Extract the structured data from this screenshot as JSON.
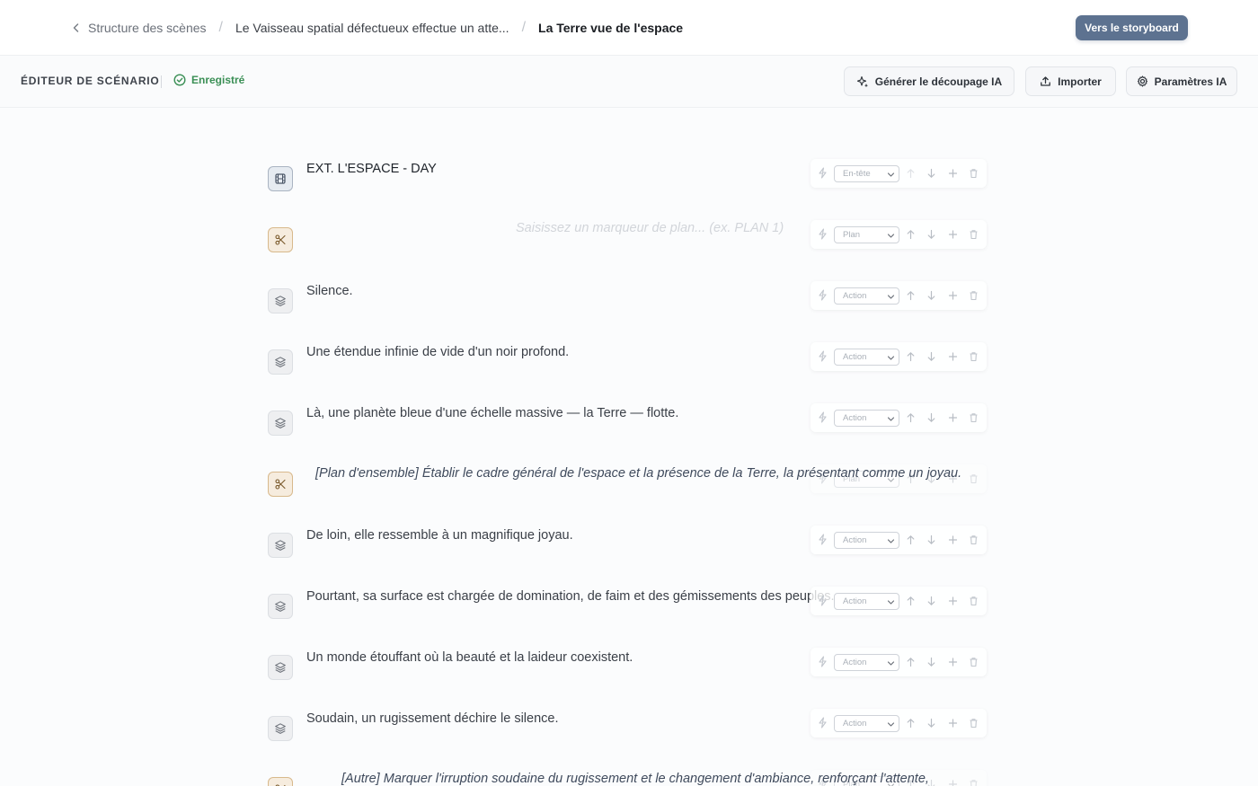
{
  "breadcrumb": {
    "back_label": "Structure des scènes",
    "middle_label": "Le Vaisseau spatial défectueux effectue un atte...",
    "current_label": "La Terre vue de l'espace"
  },
  "header": {
    "primary_button_label": "Vers le storyboard"
  },
  "toolbar": {
    "title": "ÉDITEUR DE SCÉNARIO",
    "save_status": "Enregistré",
    "generate_label": "Générer le découpage IA",
    "import_label": "Importer",
    "settings_label": "Paramètres IA"
  },
  "colors": {
    "accent": "#5d7290",
    "saved": "#3a8f55",
    "shot_icon_bg": "#f6ecde",
    "heading_icon_bg": "#e6ebf1"
  },
  "rows": [
    {
      "kind": "heading",
      "icon": "film-icon",
      "text": "EXT. L'ESPACE - DAY",
      "type_label": "En-tête"
    },
    {
      "kind": "shot",
      "icon": "scissors-icon",
      "text": "",
      "placeholder": "Saisissez un marqueur de plan... (ex. PLAN 1)",
      "type_label": "Plan"
    },
    {
      "kind": "action",
      "icon": "layers-icon",
      "text": "Silence.",
      "type_label": "Action"
    },
    {
      "kind": "action",
      "icon": "layers-icon",
      "text": "Une étendue infinie de vide d'un noir profond.",
      "type_label": "Action"
    },
    {
      "kind": "action",
      "icon": "layers-icon",
      "text": "Là, une planète bleue d'une échelle massive — la Terre — flotte.",
      "type_label": "Action"
    },
    {
      "kind": "shot",
      "icon": "scissors-icon",
      "text": "[Plan d'ensemble] Établir le cadre général de l'espace et la présence de la Terre, la présentant comme un joyau.",
      "type_label": "Plan"
    },
    {
      "kind": "action",
      "icon": "layers-icon",
      "text": "De loin, elle ressemble à un magnifique joyau.",
      "type_label": "Action"
    },
    {
      "kind": "action",
      "icon": "layers-icon",
      "text": "Pourtant, sa surface est chargée de domination, de faim et des gémissements des peuples.",
      "type_label": "Action"
    },
    {
      "kind": "action",
      "icon": "layers-icon",
      "text": "Un monde étouffant où la beauté et la laideur coexistent.",
      "type_label": "Action"
    },
    {
      "kind": "action",
      "icon": "layers-icon",
      "text": "Soudain, un rugissement déchire le silence.",
      "type_label": "Action"
    },
    {
      "kind": "shot",
      "icon": "scissors-icon",
      "text": "[Autre] Marquer l'irruption soudaine du rugissement et le changement d'ambiance, renforçant l'attente,",
      "type_label": "Plan"
    }
  ]
}
